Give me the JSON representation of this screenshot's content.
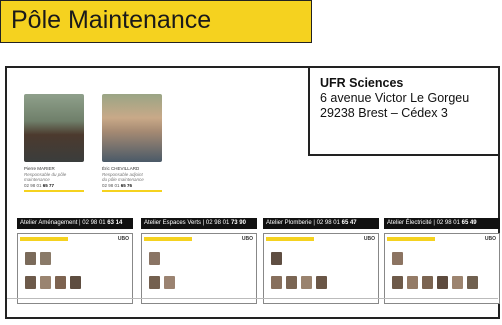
{
  "header": {
    "title": "Pôle Maintenance"
  },
  "address": {
    "name": "UFR Sciences",
    "line1": "6 avenue Victor Le Gorgeu",
    "line2": "29238 Brest – Cédex 3"
  },
  "people": [
    {
      "name": "Pierre MARIER",
      "role1": "Responsable du pôle",
      "role2": "maintenance",
      "tel_prefix": "02 98 01",
      "tel_suffix": "65 77"
    },
    {
      "name": "Éric CHEVILLARD",
      "role1": "Responsable adjoint",
      "role2": "du pôle maintenance",
      "tel_prefix": "02 98 01",
      "tel_suffix": "65 76"
    }
  ],
  "ateliers": [
    {
      "label": "Atelier Aménagement | 02 98 01",
      "tel": "63 14",
      "logo": "UBO"
    },
    {
      "label": "Atelier Espaces Verts | 02 98 01",
      "tel": "73 90",
      "logo": "UBO"
    },
    {
      "label": "Atelier Plomberie | 02 98 01",
      "tel": "65 47",
      "logo": "UBO"
    },
    {
      "label": "Atelier Électricité | 02 98 01",
      "tel": "65 49",
      "logo": "UBO"
    }
  ]
}
